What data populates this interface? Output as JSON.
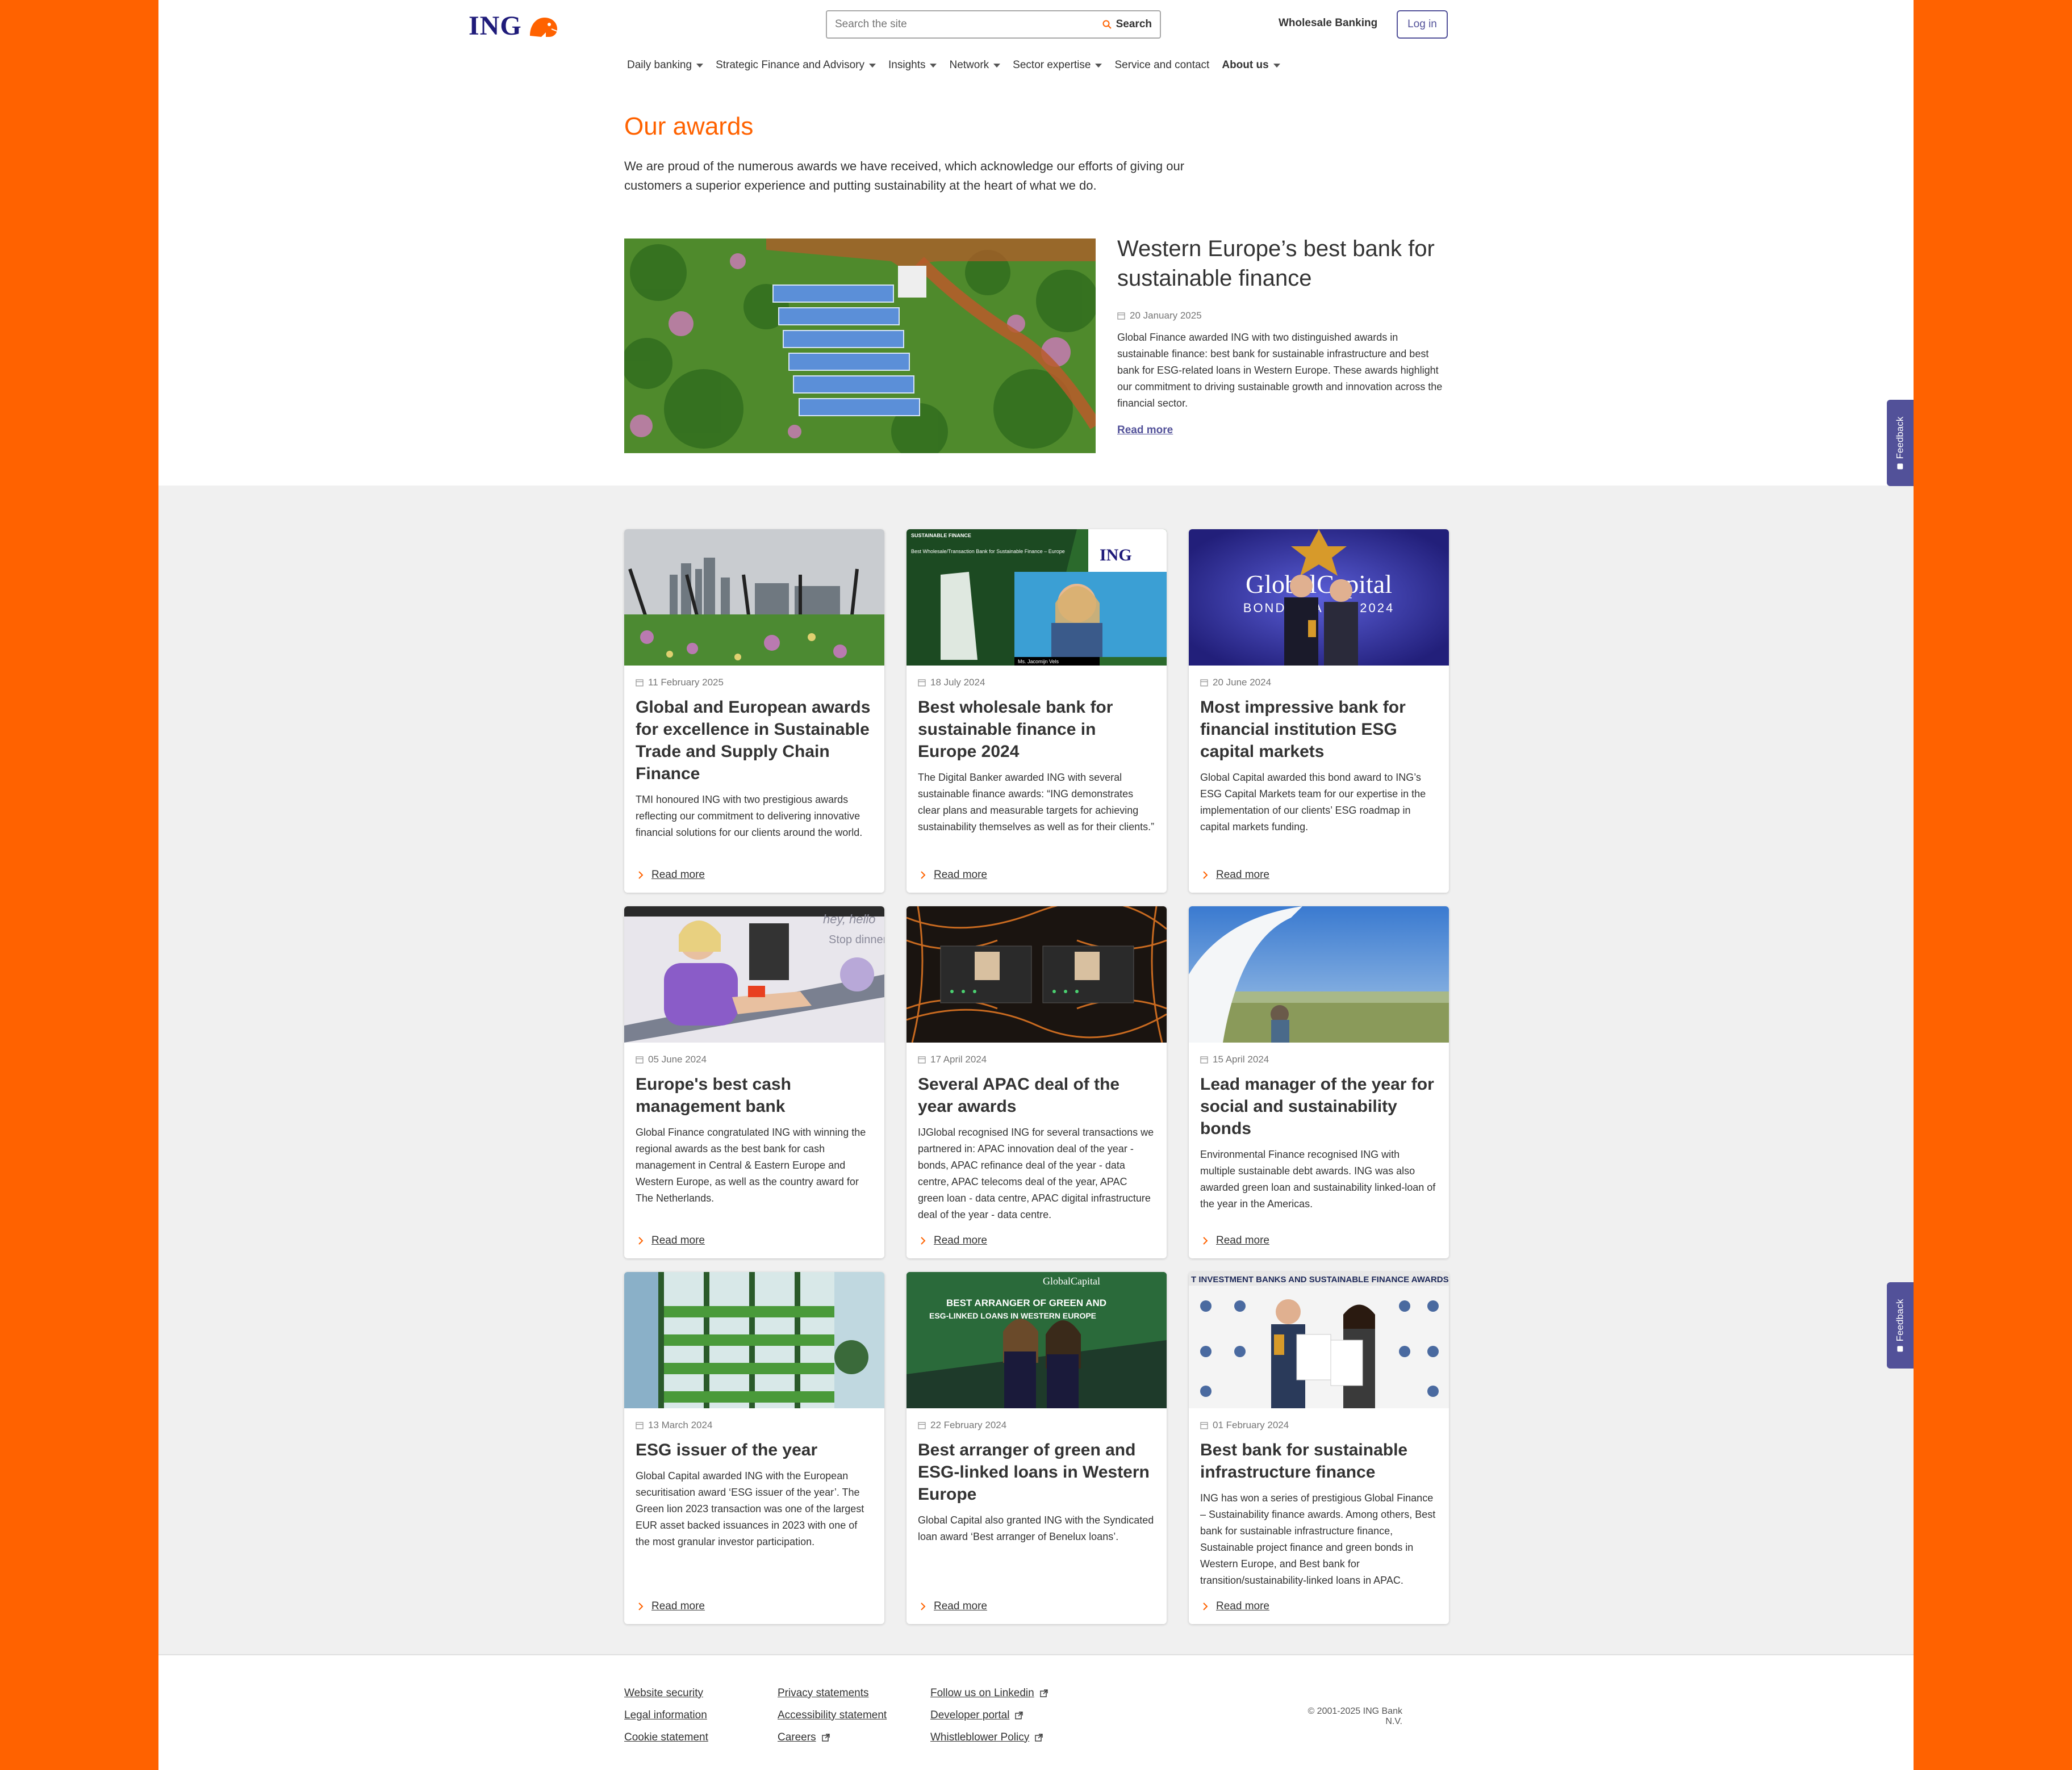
{
  "header": {
    "logo_text": "ING",
    "search_placeholder": "Search the site",
    "search_label": "Search",
    "wholesale_label": "Wholesale Banking",
    "login_label": "Log in"
  },
  "nav": [
    {
      "label": "Daily banking",
      "caret": true
    },
    {
      "label": "Strategic Finance and Advisory",
      "caret": true
    },
    {
      "label": "Insights",
      "caret": true
    },
    {
      "label": "Network",
      "caret": true
    },
    {
      "label": "Sector expertise",
      "caret": true
    },
    {
      "label": "Service and contact",
      "caret": false
    },
    {
      "label": "About us",
      "caret": true
    }
  ],
  "page": {
    "title": "Our awards",
    "intro": "We are proud of the numerous awards we have received, which acknowledge our efforts of giving our customers a superior experience and putting sustainability at the heart of what we do."
  },
  "feature": {
    "title": "Western Europe’s best bank for sustainable finance",
    "date": "20 January 2025",
    "body": "Global Finance awarded ING with two distinguished awards in sustainable finance: best bank for sustainable infrastructure and best bank for ESG-related loans in Western Europe. These awards highlight our commitment to driving sustainable growth and innovation across the financial sector.",
    "read_more": "Read more"
  },
  "cards": [
    {
      "date": "11 February 2025",
      "title": "Global and European awards for excellence in Sustainable Trade and Supply Chain Finance",
      "text": "TMI honoured ING with two prestigious awards reflecting our commitment to delivering innovative financial solutions for our clients around the world.",
      "read_more": "Read more"
    },
    {
      "date": "18 July 2024",
      "title": "Best wholesale bank for sustainable finance in Europe 2024",
      "text": "The Digital Banker awarded ING with several sustainable finance awards: “ING demonstrates clear plans and measurable targets for achieving sustainability themselves as well as for their clients.”",
      "read_more": "Read more"
    },
    {
      "date": "20 June 2024",
      "title": "Most impressive bank for financial institution ESG capital markets",
      "text": "Global Capital awarded this bond award to ING’s ESG Capital Markets team for our expertise in the implementation of our clients’ ESG roadmap in capital markets funding.",
      "read_more": "Read more"
    },
    {
      "date": "05 June 2024",
      "title": "Europe's best cash management bank",
      "text": "Global Finance congratulated ING with winning the regional awards as the best bank for cash management in Central & Eastern Europe and Western Europe, as well as the country award for The Netherlands.",
      "read_more": "Read more"
    },
    {
      "date": "17 April 2024",
      "title": "Several APAC deal of the year awards",
      "text": "IJGlobal recognised ING for several transactions we partnered in: APAC innovation deal of the year - bonds, APAC refinance deal of the year - data centre, APAC telecoms deal of the year, APAC green loan - data centre, APAC digital infrastructure deal of the year - data centre.",
      "read_more": "Read more"
    },
    {
      "date": "15 April 2024",
      "title": "Lead manager of the year for social and sustainability bonds",
      "text": "Environmental Finance recognised ING with multiple sustainable debt awards. ING was also awarded green loan and sustainability linked-loan of the year in the Americas.",
      "read_more": "Read more"
    },
    {
      "date": "13 March 2024",
      "title": "ESG issuer of the year",
      "text": "Global Capital awarded ING with the European securitisation award ‘ESG issuer of the year’. The Green lion 2023 transaction was one of the largest EUR asset backed issuances in 2023 with one of the most granular investor participation.",
      "read_more": "Read more"
    },
    {
      "date": "22 February 2024",
      "title": "Best arranger of green and ESG-linked loans in Western Europe",
      "text": "Global Capital also granted ING with the Syndicated loan award ‘Best arranger of Benelux loans’.",
      "read_more": "Read more"
    },
    {
      "date": "01 February 2024",
      "title": "Best bank for sustainable infrastructure finance",
      "text": "ING has won a series of prestigious Global Finance – Sustainability finance awards. Among others, Best bank for sustainable infrastructure finance, Sustainable project finance and green bonds in Western Europe, and Best bank for transition/sustainability-linked loans in APAC.",
      "read_more": "Read more"
    }
  ],
  "card_images": {
    "c1_skyline": "",
    "c2_heading": "SUSTAINABLE FINANCE",
    "c2_sub": "Best Wholesale/Transaction Bank for Sustainable Finance – Europe",
    "c2_name": "Ms. Jacomijn Vels",
    "c2_logo": "ING",
    "c3_sign": "GlobalCapital",
    "c3_sub": "BOND AWARDS 2024",
    "c4_sign": "hey, hello",
    "c4_sub": "Stop dinner",
    "c8_sign": "BEST ARRANGER OF GREEN AND",
    "c8_sign2": "ESG-LINKED LOANS IN WESTERN EUROPE",
    "c8_logo": "GlobalCapital",
    "c9_banner": "T INVESTMENT BANKS AND SUSTAINABLE FINANCE AWARDS CEREMO"
  },
  "footer": {
    "col1": [
      "Website security",
      "Legal information",
      "Cookie statement"
    ],
    "col2": [
      "Privacy statements",
      "Accessibility statement",
      "Careers"
    ],
    "col3": [
      "Follow us on Linkedin",
      "Developer portal",
      "Whistleblower Policy"
    ],
    "copyright": "© 2001-2025 ING Bank N.V."
  },
  "feedback_label": "Feedback",
  "colors": {
    "brand_orange": "#ff6200",
    "indigo": "#525199",
    "logo_blue": "#1f1b7a"
  }
}
